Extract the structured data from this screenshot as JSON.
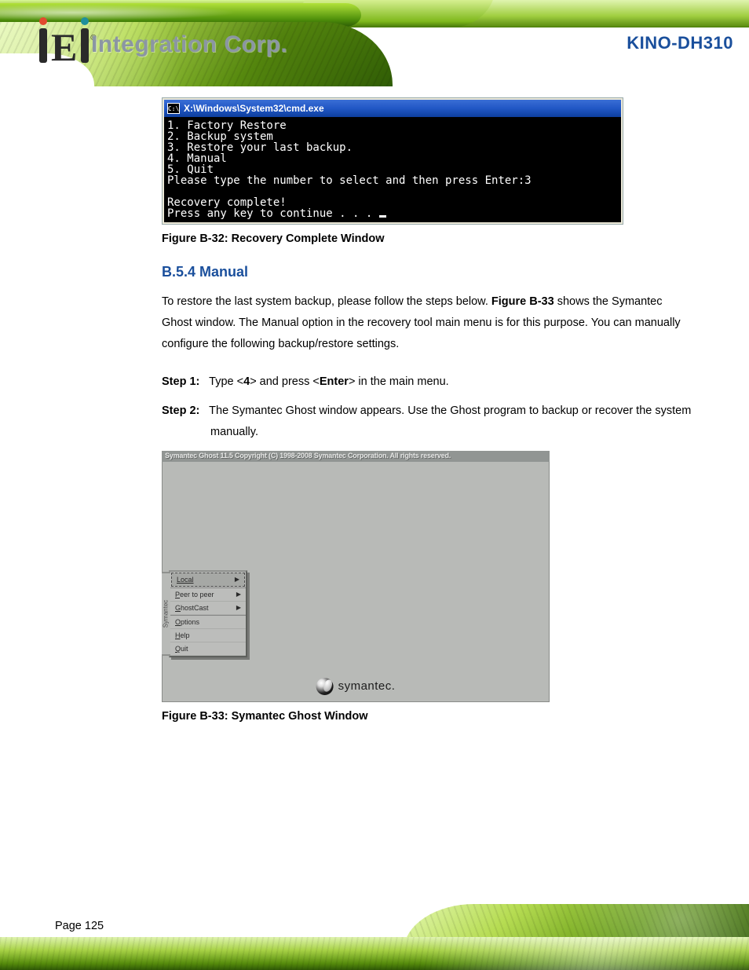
{
  "header": {
    "brand_text": "Integration Corp.",
    "model": "KINO-DH310"
  },
  "cmd": {
    "title": "X:\\Windows\\System32\\cmd.exe",
    "icon_label": "C:\\",
    "lines": [
      "1. Factory Restore",
      "2. Backup system",
      "3. Restore your last backup.",
      "4. Manual",
      "5. Quit",
      "Please type the number to select and then press Enter:3",
      "",
      "Recovery complete!",
      "Press any key to continue . . . "
    ]
  },
  "figures": {
    "f1": "Figure B-32: Recovery Complete Window",
    "f2": "Figure B-33: Symantec Ghost Window"
  },
  "section": {
    "heading": "B.5.4  Manual",
    "para_pre": "To restore the last system backup, please follow the steps below.",
    "para_post": " shows the Symantec Ghost window. The Manual option in the recovery tool main menu is for this purpose. You can manually configure the following backup/restore settings.",
    "steps": {
      "s1_no": "Step 1:",
      "s1_text_a": "Type <",
      "s1_key": "4",
      "s1_text_b": "> and press <",
      "s1_enter": "Enter",
      "s1_text_c": "> in the main menu.",
      "s2_no": "Step 2:",
      "s2_text_a": "The Symantec Ghost window appears. Use the Ghost program to backup or recover the system manually."
    }
  },
  "ghost": {
    "title": "Symantec Ghost 11.5    Copyright (C) 1998-2008 Symantec Corporation. All rights reserved.",
    "tab": "Symantec",
    "menu": {
      "local": "Local",
      "peer": "Peer to peer",
      "ghostcast": "GhostCast",
      "options": "Options",
      "help": "Help",
      "quit": "Quit"
    },
    "logo_text": "symantec."
  },
  "footer": {
    "page": "Page 125"
  }
}
